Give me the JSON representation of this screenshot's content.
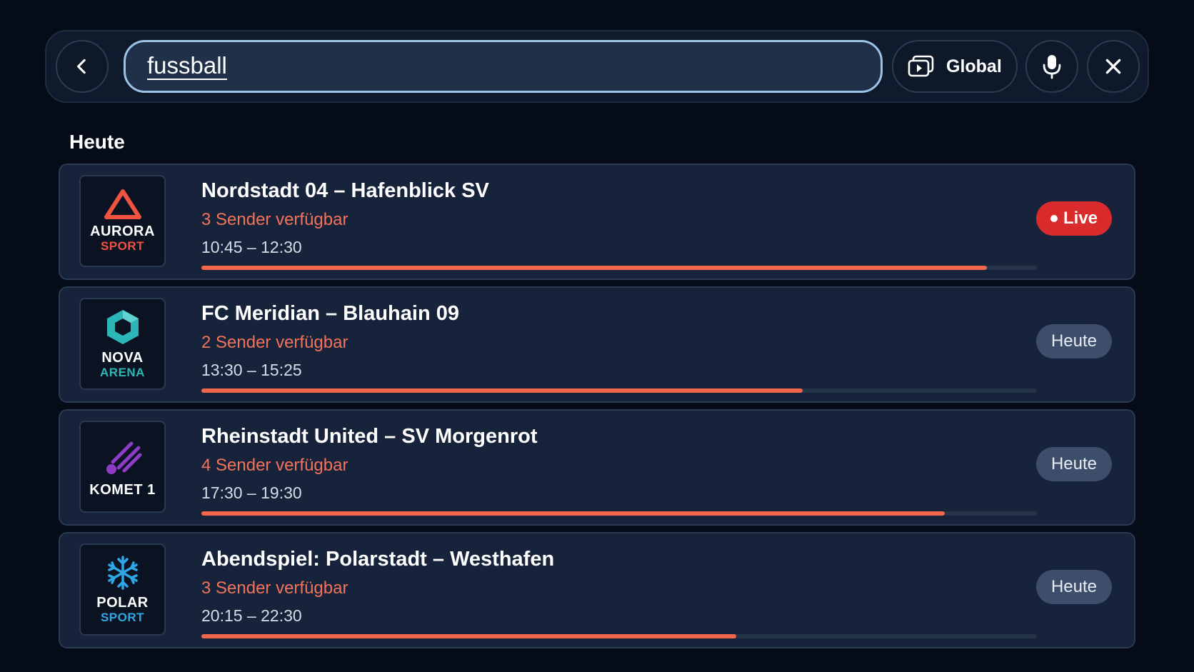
{
  "search": {
    "query": "fussball"
  },
  "toolbar": {
    "scope_label": "Global"
  },
  "section": {
    "title": "Heute"
  },
  "results": [
    {
      "logo_line1": "AURORA",
      "logo_line2": "SPORT",
      "logo_color": "#f0533f",
      "title": "Nordstadt 04 – Hafenblick SV",
      "channels": "3 Sender verfügbar",
      "time": "10:45 – 12:30",
      "progress": 0.94,
      "badge": "Live",
      "badge_type": "live"
    },
    {
      "logo_line1": "NOVA",
      "logo_line2": "ARENA",
      "logo_color": "#2bb7b7",
      "title": "FC Meridian – Blauhain 09",
      "channels": "2 Sender verfügbar",
      "time": "13:30 – 15:25",
      "progress": 0.72,
      "badge": "Heute",
      "badge_type": "today"
    },
    {
      "logo_line1": "KOMET 1",
      "logo_line2": "",
      "logo_color": "#8e3bc6",
      "title": "Rheinstadt United – SV Morgenrot",
      "channels": "4 Sender verfügbar",
      "time": "17:30 – 19:30",
      "progress": 0.89,
      "badge": "Heute",
      "badge_type": "today"
    },
    {
      "logo_line1": "POLAR",
      "logo_line2": "SPORT",
      "logo_color": "#2fa7e6",
      "title": "Abendspiel: Polarstadt – Westhafen",
      "channels": "3 Sender verfügbar",
      "time": "20:15 – 22:30",
      "progress": 0.64,
      "badge": "Heute",
      "badge_type": "today"
    }
  ],
  "colors": {
    "background": "#050b17",
    "accent": "#f0674c",
    "live": "#d92b2b",
    "card": "#16233a"
  }
}
